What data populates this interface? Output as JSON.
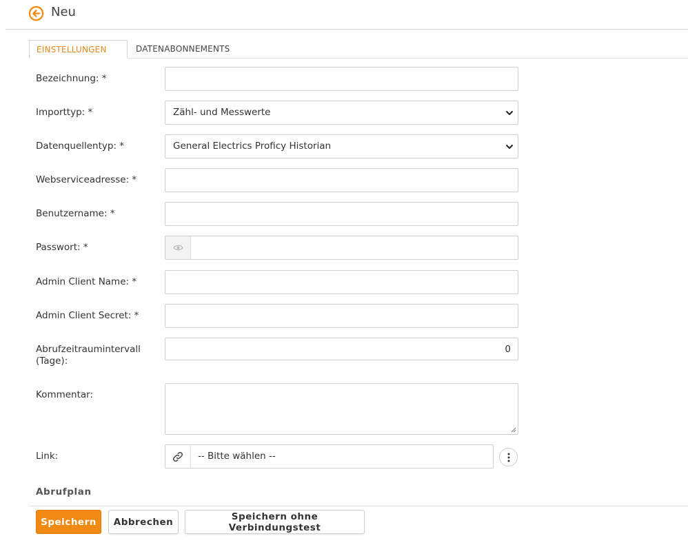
{
  "header": {
    "title": "Neu"
  },
  "tabs": [
    {
      "label": "EINSTELLUNGEN",
      "active": true
    },
    {
      "label": "DATENABONNEMENTS",
      "active": false
    }
  ],
  "form": {
    "bezeichnung": {
      "label": "Bezeichnung: *",
      "value": ""
    },
    "importtyp": {
      "label": "Importtyp: *",
      "value": "Zähl- und Messwerte"
    },
    "datenquellentyp": {
      "label": "Datenquellentyp: *",
      "value": "General Electrics Proficy Historian"
    },
    "webserviceadresse": {
      "label": "Webserviceadresse: *",
      "value": ""
    },
    "benutzername": {
      "label": "Benutzername: *",
      "value": ""
    },
    "passwort": {
      "label": "Passwort: *",
      "value": ""
    },
    "admin_client_name": {
      "label": "Admin Client Name: *",
      "value": ""
    },
    "admin_client_secret": {
      "label": "Admin Client Secret: *",
      "value": ""
    },
    "abrufzeitraum": {
      "label_line1": "Abrufzeitraumintervall",
      "label_line2": "(Tage):",
      "value": "0"
    },
    "kommentar": {
      "label": "Kommentar:",
      "value": ""
    },
    "link": {
      "label": "Link:",
      "value": "-- Bitte wählen --"
    }
  },
  "section": {
    "abrufplan": "Abrufplan"
  },
  "buttons": {
    "save": "Speichern",
    "cancel": "Abbrechen",
    "save_no_test": "Speichern ohne Verbindungstest"
  },
  "colors": {
    "accent": "#f08a12",
    "tab_active": "#e8891d",
    "border": "#cfcfcf"
  },
  "icons": {
    "back": "arrow-left-circle-icon",
    "password": "eye-icon",
    "link": "link-icon",
    "more": "vertical-dots-icon",
    "select": "chevron-down-icon"
  }
}
